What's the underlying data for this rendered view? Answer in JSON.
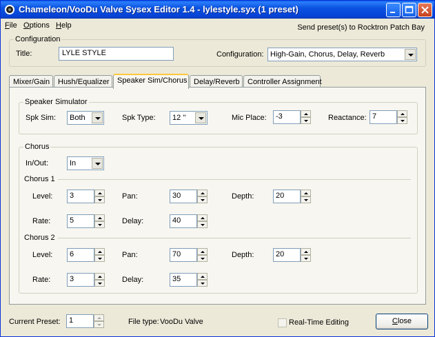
{
  "window": {
    "title": "Chameleon/VooDu Valve Sysex Editor 1.4 - lylestyle.syx (1 preset)",
    "minimize_glyph": "_",
    "maximize_glyph": "□",
    "close_glyph": "×"
  },
  "menu": {
    "items": [
      {
        "label": "File",
        "underline": "F",
        "rest": "ile"
      },
      {
        "label": "Options",
        "underline": "O",
        "rest": "ptions"
      },
      {
        "label": "Help",
        "underline": "H",
        "rest": "elp"
      }
    ],
    "send_link": "Send preset(s) to Rocktron Patch Bay"
  },
  "configuration": {
    "legend": "Configuration",
    "title_label": "Title:",
    "title_value": "LYLE STYLE",
    "config_label": "Configuration:",
    "config_value": "High-Gain, Chorus, Delay, Reverb"
  },
  "tabs": [
    {
      "label": "Mixer/Gain"
    },
    {
      "label": "Hush/Equalizer"
    },
    {
      "label": "Speaker Sim/Chorus"
    },
    {
      "label": "Delay/Reverb"
    },
    {
      "label": "Controller Assignment"
    }
  ],
  "speaker_sim": {
    "legend": "Speaker Simulator",
    "spk_sim_label": "Spk Sim:",
    "spk_sim_value": "Both",
    "spk_type_label": "Spk Type:",
    "spk_type_value": "12 ''",
    "mic_place_label": "Mic Place:",
    "mic_place_value": "-3",
    "reactance_label": "Reactance:",
    "reactance_value": "7"
  },
  "chorus": {
    "legend": "Chorus",
    "inout_label": "In/Out:",
    "inout_value": "In",
    "chorus1": {
      "heading": "Chorus 1",
      "level_label": "Level:",
      "level_value": "3",
      "pan_label": "Pan:",
      "pan_value": "30",
      "depth_label": "Depth:",
      "depth_value": "20",
      "rate_label": "Rate:",
      "rate_value": "5",
      "delay_label": "Delay:",
      "delay_value": "40"
    },
    "chorus2": {
      "heading": "Chorus 2",
      "level_label": "Level:",
      "level_value": "6",
      "pan_label": "Pan:",
      "pan_value": "70",
      "depth_label": "Depth:",
      "depth_value": "20",
      "rate_label": "Rate:",
      "rate_value": "3",
      "delay_label": "Delay:",
      "delay_value": "35"
    }
  },
  "footer": {
    "current_preset_label": "Current Preset:",
    "current_preset_value": "1",
    "file_type_label": "File type:",
    "file_type_value": "VooDu Valve",
    "realtime_label": "Real-Time Editing",
    "realtime_checked": false,
    "close_underline": "C",
    "close_rest": "lose"
  }
}
